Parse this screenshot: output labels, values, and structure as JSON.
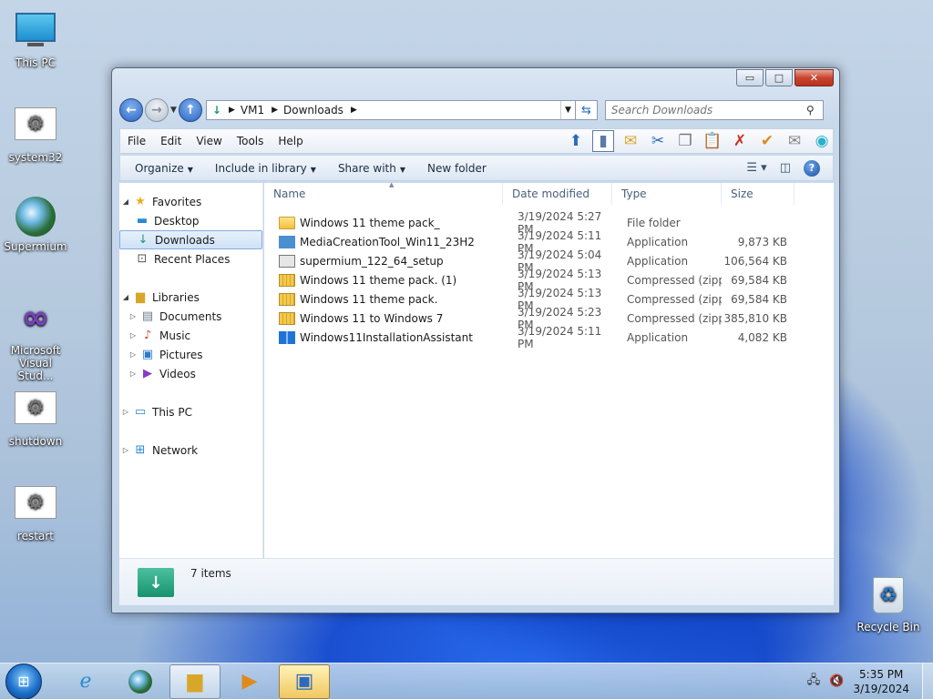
{
  "desktop": {
    "icons": [
      {
        "label": "This PC"
      },
      {
        "label": "system32"
      },
      {
        "label": "Supermium"
      },
      {
        "label": "Microsoft Visual Stud..."
      },
      {
        "label": "shutdown"
      },
      {
        "label": "restart"
      },
      {
        "label": "Recycle Bin"
      }
    ]
  },
  "window": {
    "controls": {
      "minimize": "▭",
      "maximize": "□",
      "close": "✕"
    },
    "address": {
      "crumbs": [
        "VM1",
        "Downloads"
      ]
    },
    "search": {
      "placeholder": "Search Downloads"
    },
    "menu": [
      "File",
      "Edit",
      "View",
      "Tools",
      "Help"
    ],
    "commands": {
      "organize": "Organize",
      "include": "Include in library",
      "share": "Share with",
      "new_folder": "New folder"
    },
    "nav": {
      "favorites": "Favorites",
      "desktop": "Desktop",
      "downloads": "Downloads",
      "recent": "Recent Places",
      "libraries": "Libraries",
      "documents": "Documents",
      "music": "Music",
      "pictures": "Pictures",
      "videos": "Videos",
      "thispc": "This PC",
      "network": "Network"
    },
    "columns": {
      "name": "Name",
      "date": "Date modified",
      "type": "Type",
      "size": "Size"
    },
    "files": [
      {
        "name": "Windows 11 theme pack_",
        "date": "3/19/2024 5:27 PM",
        "type": "File folder",
        "size": "",
        "icon": "folder"
      },
      {
        "name": "MediaCreationTool_Win11_23H2",
        "date": "3/19/2024 5:11 PM",
        "type": "Application",
        "size": "9,873 KB",
        "icon": "app"
      },
      {
        "name": "supermium_122_64_setup",
        "date": "3/19/2024 5:04 PM",
        "type": "Application",
        "size": "106,564 KB",
        "icon": "app2"
      },
      {
        "name": "Windows 11 theme pack. (1)",
        "date": "3/19/2024 5:13 PM",
        "type": "Compressed (zipp...",
        "size": "69,584 KB",
        "icon": "zip"
      },
      {
        "name": "Windows 11 theme pack.",
        "date": "3/19/2024 5:13 PM",
        "type": "Compressed (zipp...",
        "size": "69,584 KB",
        "icon": "zip"
      },
      {
        "name": "Windows 11 to Windows 7",
        "date": "3/19/2024 5:23 PM",
        "type": "Compressed (zipp...",
        "size": "385,810 KB",
        "icon": "zip"
      },
      {
        "name": "Windows11InstallationAssistant",
        "date": "3/19/2024 5:11 PM",
        "type": "Application",
        "size": "4,082 KB",
        "icon": "win"
      }
    ],
    "details": {
      "count": "7 items"
    }
  },
  "taskbar": {
    "time": "5:35 PM",
    "date": "3/19/2024"
  }
}
